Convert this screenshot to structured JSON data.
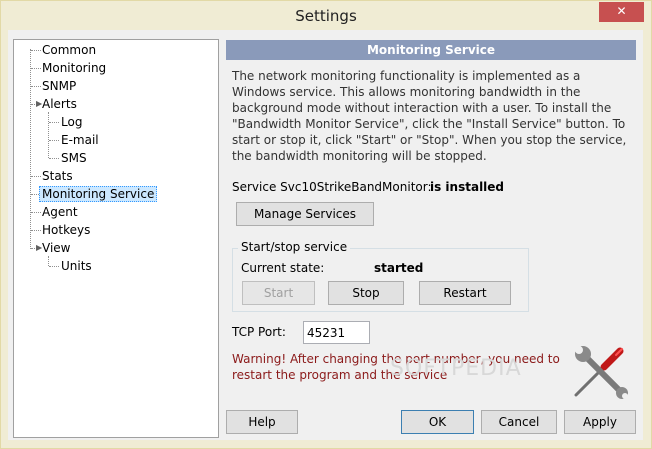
{
  "window": {
    "title": "Settings",
    "close_glyph": "✕"
  },
  "tree": {
    "items": [
      {
        "label": "Common"
      },
      {
        "label": "Monitoring"
      },
      {
        "label": "SNMP"
      },
      {
        "label": "Alerts",
        "expander": "▲"
      },
      {
        "label": "Log"
      },
      {
        "label": "E-mail"
      },
      {
        "label": "SMS"
      },
      {
        "label": "Stats"
      },
      {
        "label": "Monitoring Service",
        "selected": true
      },
      {
        "label": "Agent"
      },
      {
        "label": "Hotkeys"
      },
      {
        "label": "View",
        "expander": "▲"
      },
      {
        "label": "Units"
      }
    ]
  },
  "panel": {
    "header": "Monitoring Service",
    "description": "The network monitoring functionality is implemented as a Windows service. This allows monitoring bandwidth in the background mode without interaction with a user. To install the \"Bandwidth Monitor Service\", click the \"Install Service\" button. To start or stop it, click \"Start\" or \"Stop\". When you stop the service, the bandwidth monitoring will be stopped.",
    "service_label": "Service Svc10StrikeBandMonitor:",
    "service_status": "is installed",
    "manage_services": "Manage Services",
    "group_title": "Start/stop service",
    "current_state_label": "Current state:",
    "current_state_value": "started",
    "start": "Start",
    "stop": "Stop",
    "restart": "Restart",
    "tcp_port_label": "TCP Port:",
    "tcp_port_value": "45231",
    "warning": "Warning! After changing the port number, you need to restart the program and the service",
    "watermark": "SOFTPEDIA"
  },
  "footer": {
    "help": "Help",
    "ok": "OK",
    "cancel": "Cancel",
    "apply": "Apply"
  },
  "colors": {
    "header_bg": "#8a9aba",
    "warning_text": "#8b1a1a",
    "close_bg": "#c75050",
    "selection_bg": "#cce8ff"
  },
  "icons": {
    "tools": "wrench-screwdriver-icon",
    "close": "close-icon",
    "expander": "triangle-expander-icon"
  }
}
